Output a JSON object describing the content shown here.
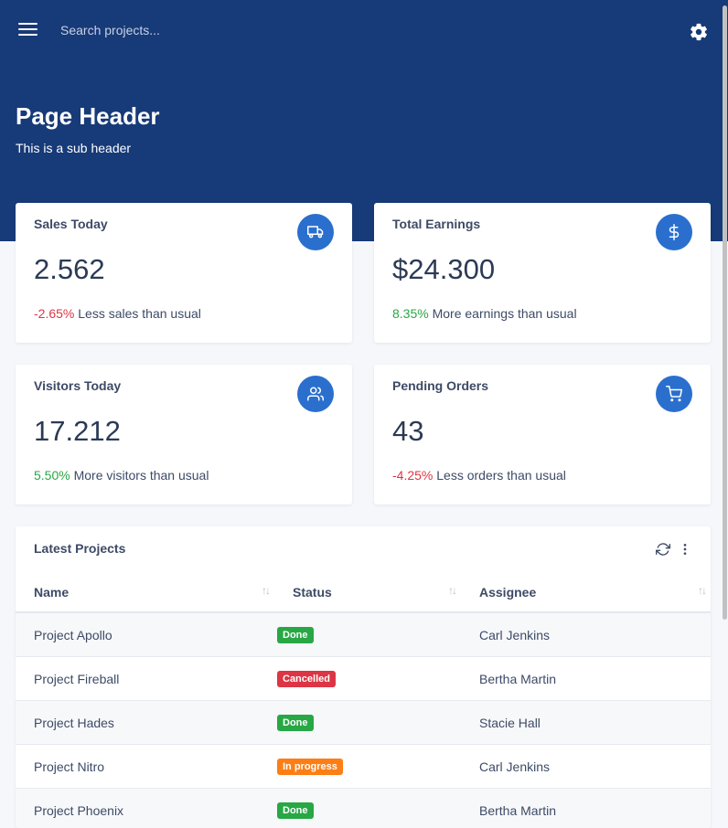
{
  "header": {
    "search_placeholder": "Search projects...",
    "title": "Page Header",
    "subtitle": "This is a sub header"
  },
  "stats": [
    {
      "title": "Sales Today",
      "value": "2.562",
      "change": "-2.65%",
      "change_type": "negative",
      "note": "Less sales than usual",
      "icon": "truck-icon"
    },
    {
      "title": "Total Earnings",
      "value": "$24.300",
      "change": "8.35%",
      "change_type": "positive",
      "note": "More earnings than usual",
      "icon": "dollar-icon"
    },
    {
      "title": "Visitors Today",
      "value": "17.212",
      "change": "5.50%",
      "change_type": "positive",
      "note": "More visitors than usual",
      "icon": "users-icon"
    },
    {
      "title": "Pending Orders",
      "value": "43",
      "change": "-4.25%",
      "change_type": "negative",
      "note": "Less orders than usual",
      "icon": "cart-icon"
    }
  ],
  "projects": {
    "title": "Latest Projects",
    "columns": [
      "Name",
      "Status",
      "Assignee"
    ],
    "sort_glyph": "↑↓",
    "rows": [
      {
        "name": "Project Apollo",
        "status": "Done",
        "assignee": "Carl Jenkins"
      },
      {
        "name": "Project Fireball",
        "status": "Cancelled",
        "assignee": "Bertha Martin"
      },
      {
        "name": "Project Hades",
        "status": "Done",
        "assignee": "Stacie Hall"
      },
      {
        "name": "Project Nitro",
        "status": "In progress",
        "assignee": "Carl Jenkins"
      },
      {
        "name": "Project Phoenix",
        "status": "Done",
        "assignee": "Bertha Martin"
      }
    ]
  },
  "colors": {
    "header_bg": "#173a78",
    "accent": "#2a6fce",
    "positive": "#28a745",
    "negative": "#dc3545",
    "in_progress": "#fd7e14"
  }
}
